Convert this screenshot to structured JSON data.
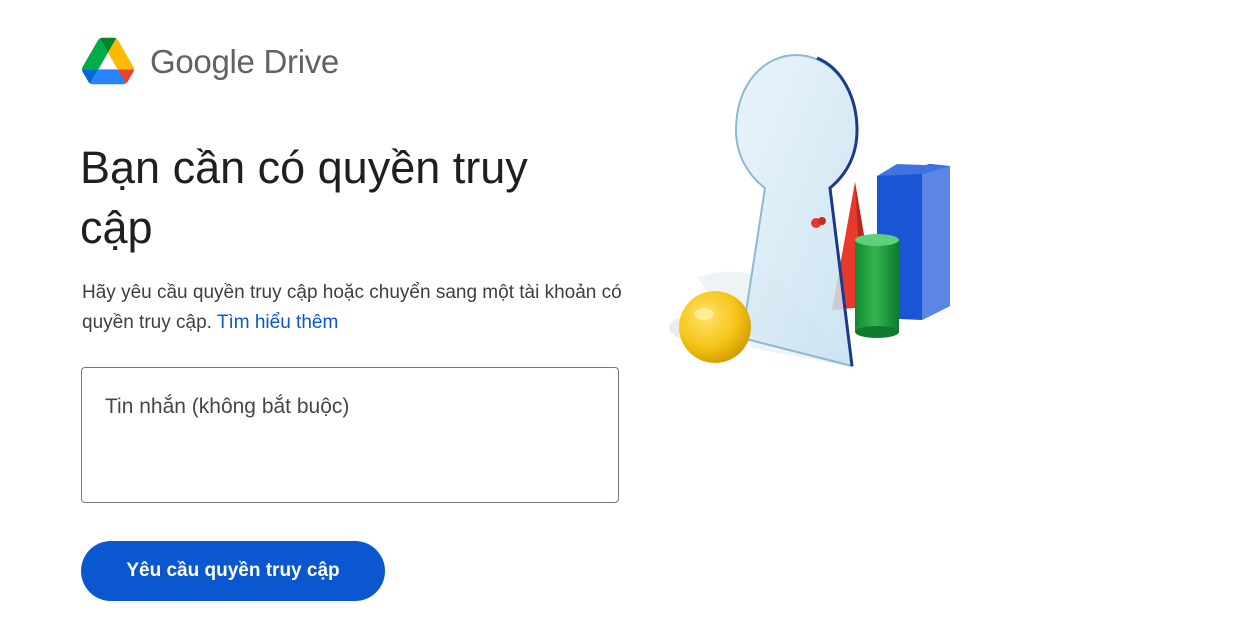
{
  "brand": {
    "name": "Google Drive",
    "logo_icon": "google-drive-logo-icon"
  },
  "heading": "Bạn cần có quyền truy cập",
  "description": {
    "text": "Hãy yêu cầu quyền truy cập hoặc chuyển sang một tài khoản có quyền truy cập.",
    "link_label": "Tìm hiểu thêm"
  },
  "message": {
    "placeholder": "Tin nhắn (không bắt buộc)",
    "value": ""
  },
  "request_button": {
    "label": "Yêu cầu quyền truy cập"
  },
  "illustration": {
    "icon": "keyhole-illustration-icon"
  },
  "colors": {
    "accent": "#0b57d0",
    "link": "#0b57d0",
    "heading": "#1f1f1f",
    "brand_text": "#5f6368"
  }
}
